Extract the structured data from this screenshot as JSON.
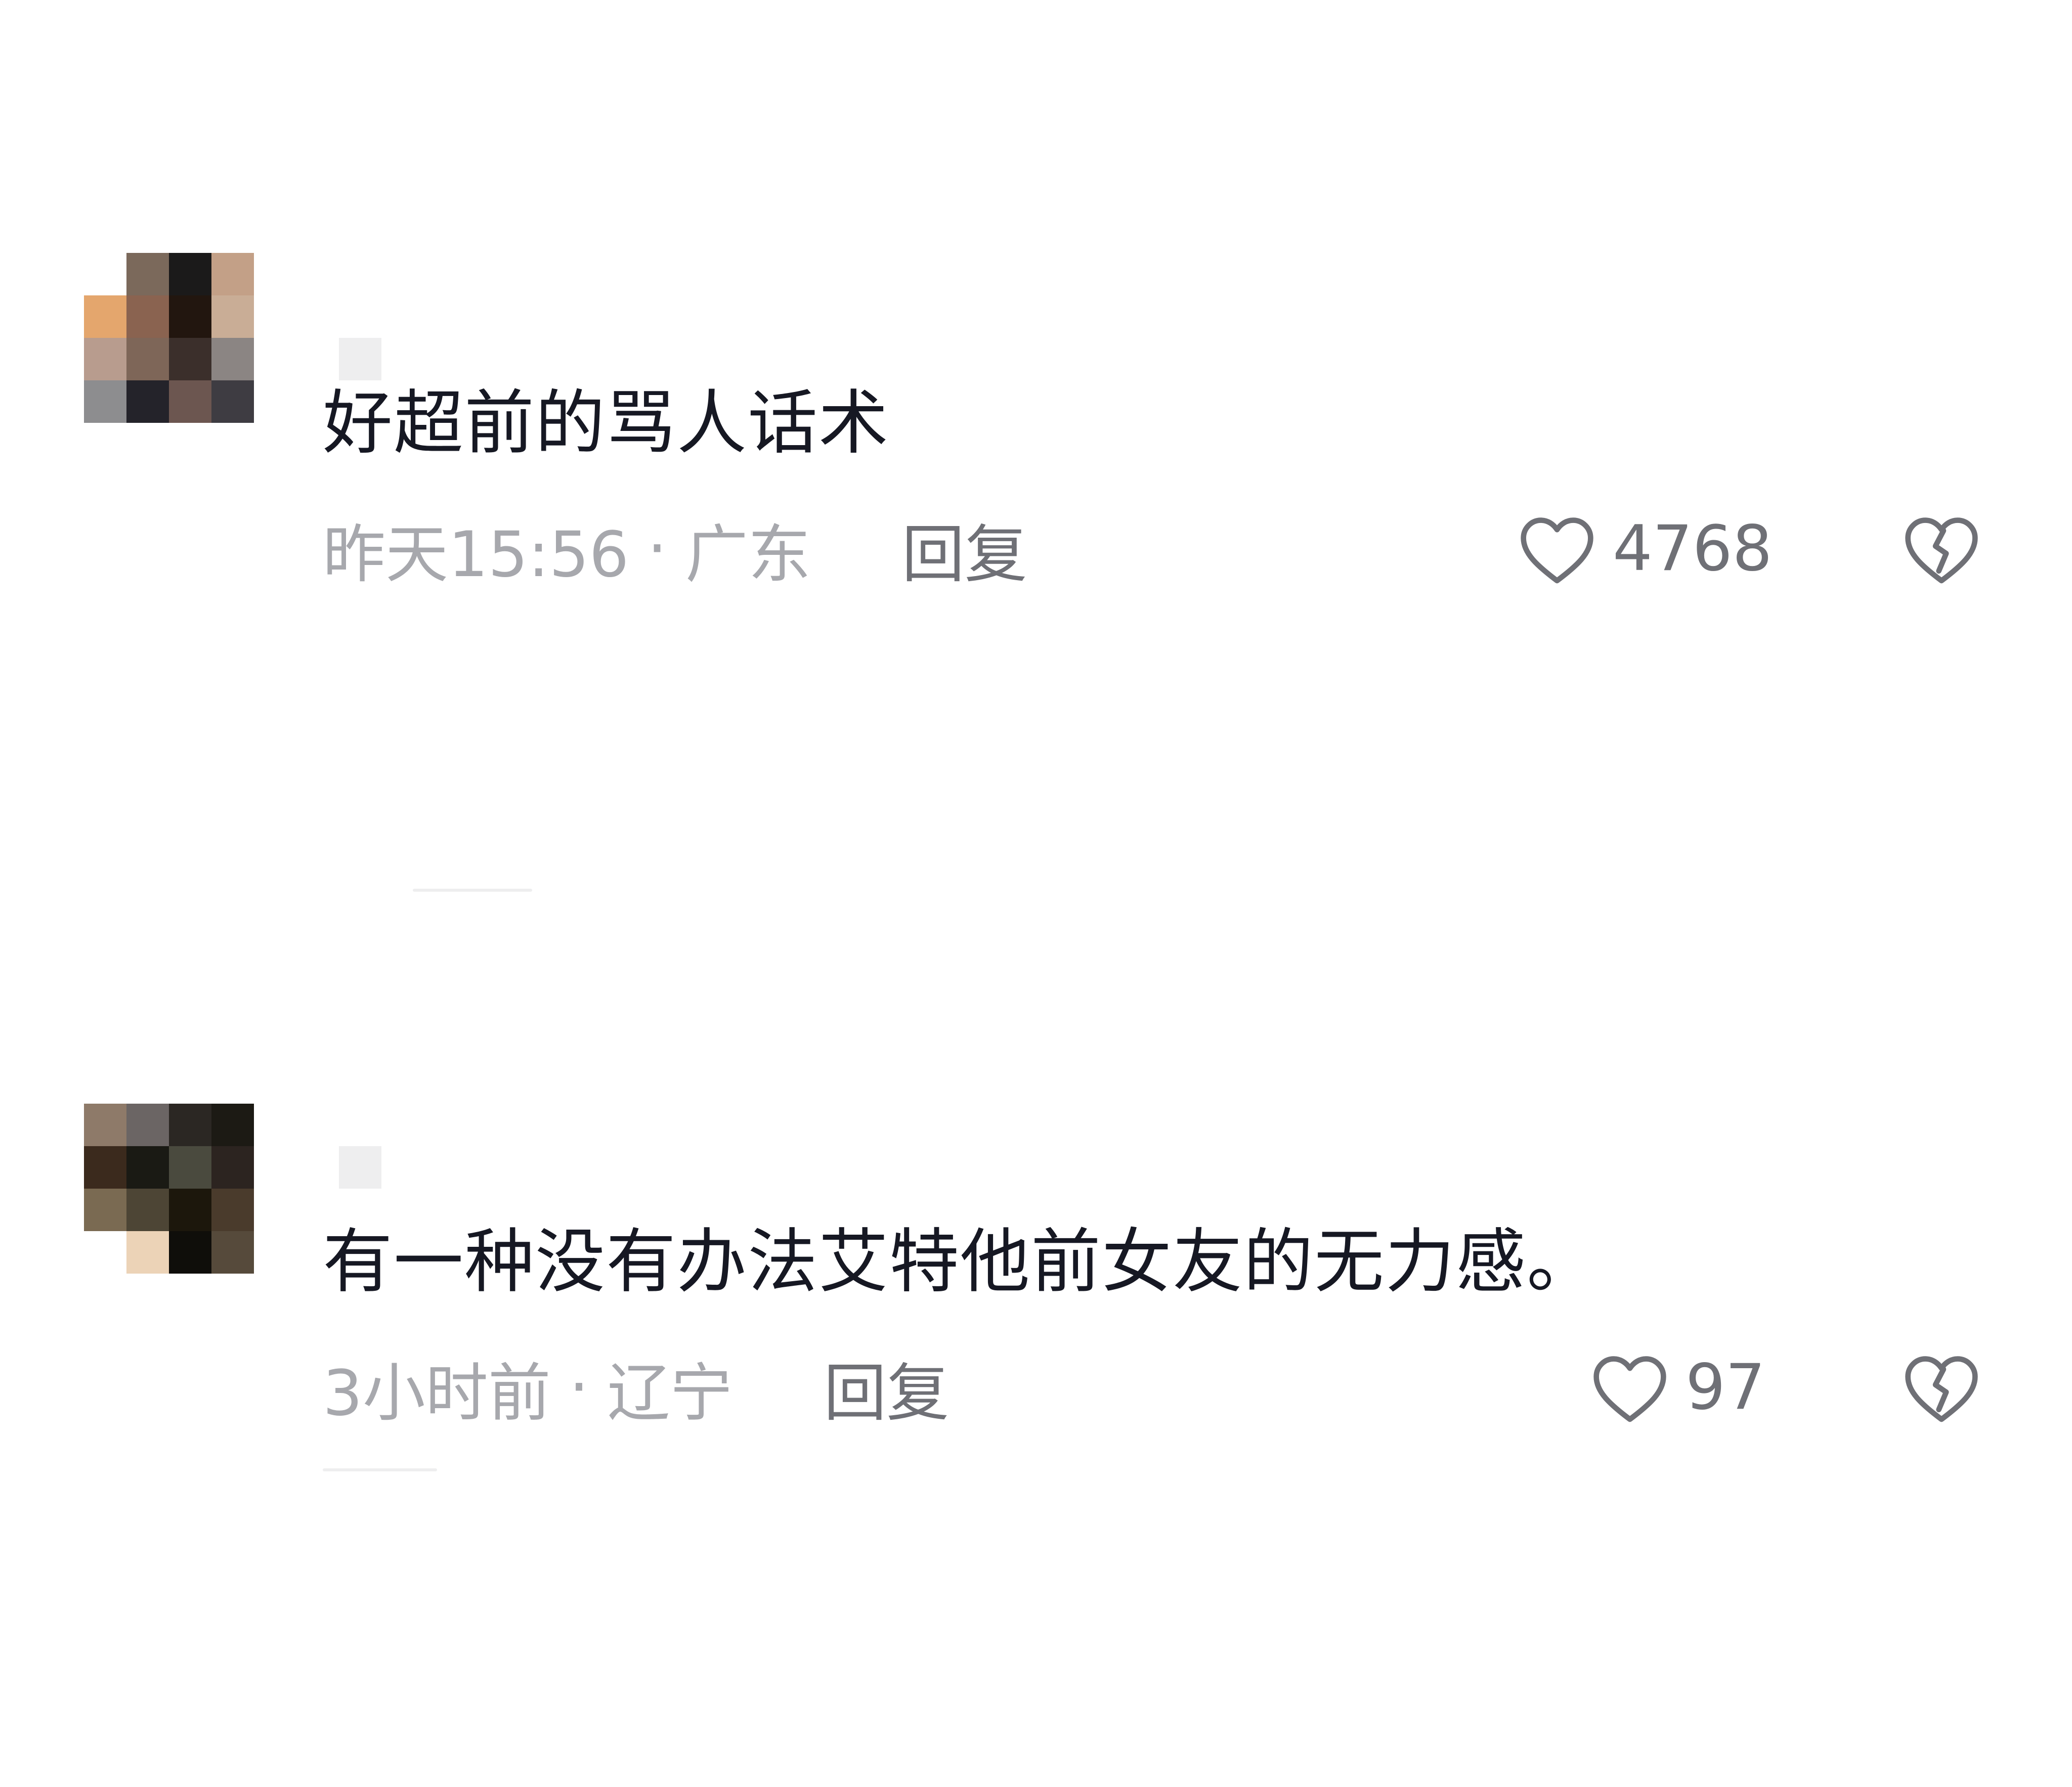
{
  "comments": [
    {
      "text": "好超前的骂人话术",
      "time": "昨天15:56",
      "separator": "·",
      "location": "广东",
      "reply_label": "回复",
      "like_count": "4768",
      "avatar_pixels": [
        [
          "#ffffff",
          "#7b695b",
          "#1b1a1a",
          "#c3a087"
        ],
        [
          "#e4a66d",
          "#8a6350",
          "#22160f",
          "#c9ad96"
        ],
        [
          "#b89c8e",
          "#7e6658",
          "#3b2f2b",
          "#8b8583"
        ],
        [
          "#8d8d8f",
          "#24232a",
          "#6c5650",
          "#3e3c42"
        ]
      ]
    },
    {
      "text": "有一种没有办法艾特他前女友的无力感。",
      "time": "3小时前",
      "separator": "·",
      "location": "辽宁",
      "reply_label": "回复",
      "like_count": "97",
      "avatar_pixels": [
        [
          "#8e7a69",
          "#6b6564",
          "#2b2723",
          "#1c1a14"
        ],
        [
          "#3b2a1d",
          "#1a1a14",
          "#4a4a3e",
          "#2c2420"
        ],
        [
          "#7a6a52",
          "#4d4535",
          "#1c170c",
          "#4a3b2c"
        ],
        [
          "#ffffff",
          "#ecd3b7",
          "#0f0e0a",
          "#564a3b"
        ]
      ]
    }
  ],
  "icons": {
    "like": "heart-outline-icon",
    "dislike": "broken-heart-icon"
  },
  "colors": {
    "text_primary": "#161823",
    "text_secondary": "#a7a8ad",
    "text_action": "#6f7076",
    "icon_stroke": "#6f7076",
    "background": "#ffffff"
  }
}
